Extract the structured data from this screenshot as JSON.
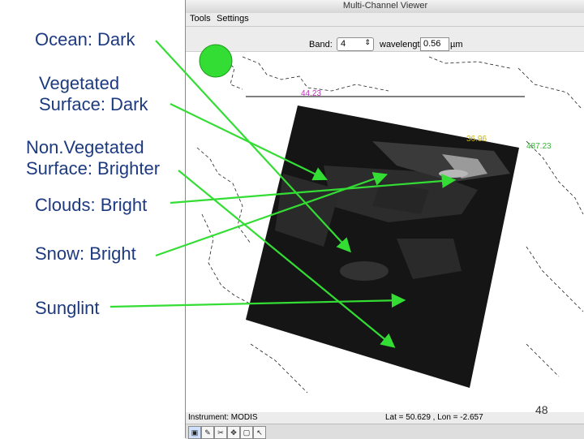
{
  "labels": {
    "ocean": "Ocean: Dark",
    "vegetated": "Vegetated\nSurface: Dark",
    "nonvegetated": "Non.Vegetated\nSurface: Brighter",
    "clouds": "Clouds: Bright",
    "snow": "Snow: Bright",
    "sunglint": "Sunglint"
  },
  "window": {
    "title": "Multi-Channel Viewer",
    "menu": [
      "Tools",
      "Settings"
    ],
    "band_label": "Band:",
    "band_value": "4",
    "wavelength_label": "wavelength",
    "wavelength_value": "0.56",
    "wavelength_unit": "µm"
  },
  "map_readouts": {
    "top_left": "44.23",
    "top_right_yellow": "36.96",
    "right_green": "487.23"
  },
  "status": {
    "instrument": "Instrument: MODIS",
    "lat_lon": "Lat = 50.629 , Lon = -2.657"
  },
  "page_number": "48",
  "colors": {
    "arrow": "#33dd33",
    "label_text": "#1d3a80",
    "marker_circle": "#33dd33"
  }
}
